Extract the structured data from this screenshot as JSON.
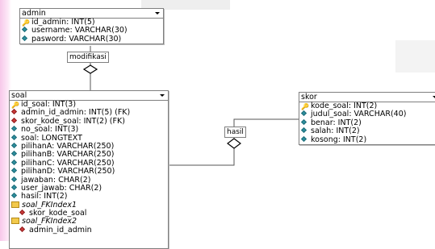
{
  "tables": {
    "admin": {
      "name": "admin",
      "columns": [
        {
          "text": "id_admin: INT(5)",
          "icon": "primary-key-icon"
        },
        {
          "text": "username: VARCHAR(30)",
          "icon": "column-icon"
        },
        {
          "text": "pasword: VARCHAR(30)",
          "icon": "column-icon"
        }
      ]
    },
    "soal": {
      "name": "soal",
      "columns": [
        {
          "text": "id_soal: INT(3)",
          "icon": "primary-key-icon"
        },
        {
          "text": "admin_id_admin: INT(5) (FK)",
          "icon": "foreign-key-icon"
        },
        {
          "text": "skor_kode_soal: INT(2) (FK)",
          "icon": "foreign-key-icon"
        },
        {
          "text": "no_soal: INT(3)",
          "icon": "column-icon"
        },
        {
          "text": "soal: LONGTEXT",
          "icon": "column-icon"
        },
        {
          "text": "pilihanA: VARCHAR(250)",
          "icon": "column-icon"
        },
        {
          "text": "pilihanB: VARCHAR(250)",
          "icon": "column-icon"
        },
        {
          "text": "pilihanC: VARCHAR(250)",
          "icon": "column-icon"
        },
        {
          "text": "pilihanD: VARCHAR(250)",
          "icon": "column-icon"
        },
        {
          "text": "jawaban: CHAR(2)",
          "icon": "column-icon"
        },
        {
          "text": "user_jawab: CHAR(2)",
          "icon": "column-icon"
        },
        {
          "text": "hasil: INT(2)",
          "icon": "column-icon"
        }
      ],
      "indexes": [
        {
          "name": "soal_FKIndex1",
          "field": "skor_kode_soal"
        },
        {
          "name": "soal_FKIndex2",
          "field": "admin_id_admin"
        }
      ]
    },
    "skor": {
      "name": "skor",
      "columns": [
        {
          "text": "kode_soal: INT(2)",
          "icon": "primary-key-icon"
        },
        {
          "text": "judul_soal: VARCHAR(40)",
          "icon": "column-icon"
        },
        {
          "text": "benar: INT(2)",
          "icon": "column-icon"
        },
        {
          "text": "salah: INT(2)",
          "icon": "column-icon"
        },
        {
          "text": "kosong: INT(2)",
          "icon": "column-icon"
        }
      ]
    }
  },
  "relations": {
    "admin_soal": "modifikasi",
    "skor_soal": "hasil"
  }
}
